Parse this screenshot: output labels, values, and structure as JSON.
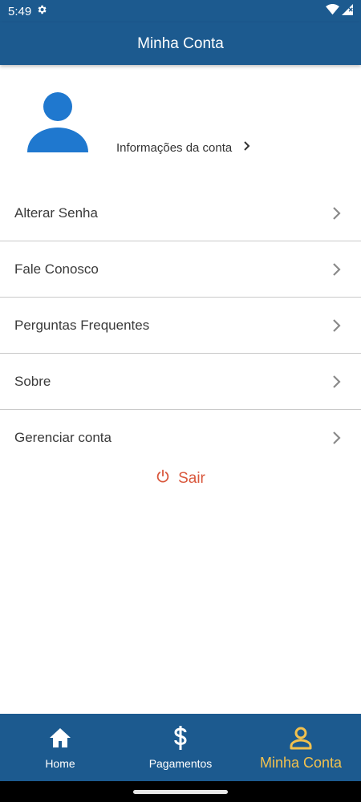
{
  "status_bar": {
    "time": "5:49",
    "icons": [
      "gear-icon",
      "wifi-icon",
      "signal-icon"
    ]
  },
  "header": {
    "title": "Minha Conta"
  },
  "profile": {
    "avatar_icon": "person-icon",
    "account_info_label": "Informações da conta"
  },
  "menu": {
    "items": [
      {
        "label": "Alterar Senha"
      },
      {
        "label": "Fale Conosco"
      },
      {
        "label": "Perguntas Frequentes"
      },
      {
        "label": "Sobre"
      },
      {
        "label": "Gerenciar conta"
      }
    ]
  },
  "logout": {
    "label": "Sair",
    "icon": "power-icon"
  },
  "bottom_nav": {
    "items": [
      {
        "label": "Home",
        "icon": "home-icon"
      },
      {
        "label": "Pagamentos",
        "icon": "dollar-icon"
      },
      {
        "label": "Minha Conta",
        "icon": "person-icon",
        "active": true
      }
    ]
  },
  "colors": {
    "primary": "#1c5a8f",
    "accent": "#f2c14e",
    "avatar": "#1f78cf",
    "logout": "#d9573c"
  }
}
